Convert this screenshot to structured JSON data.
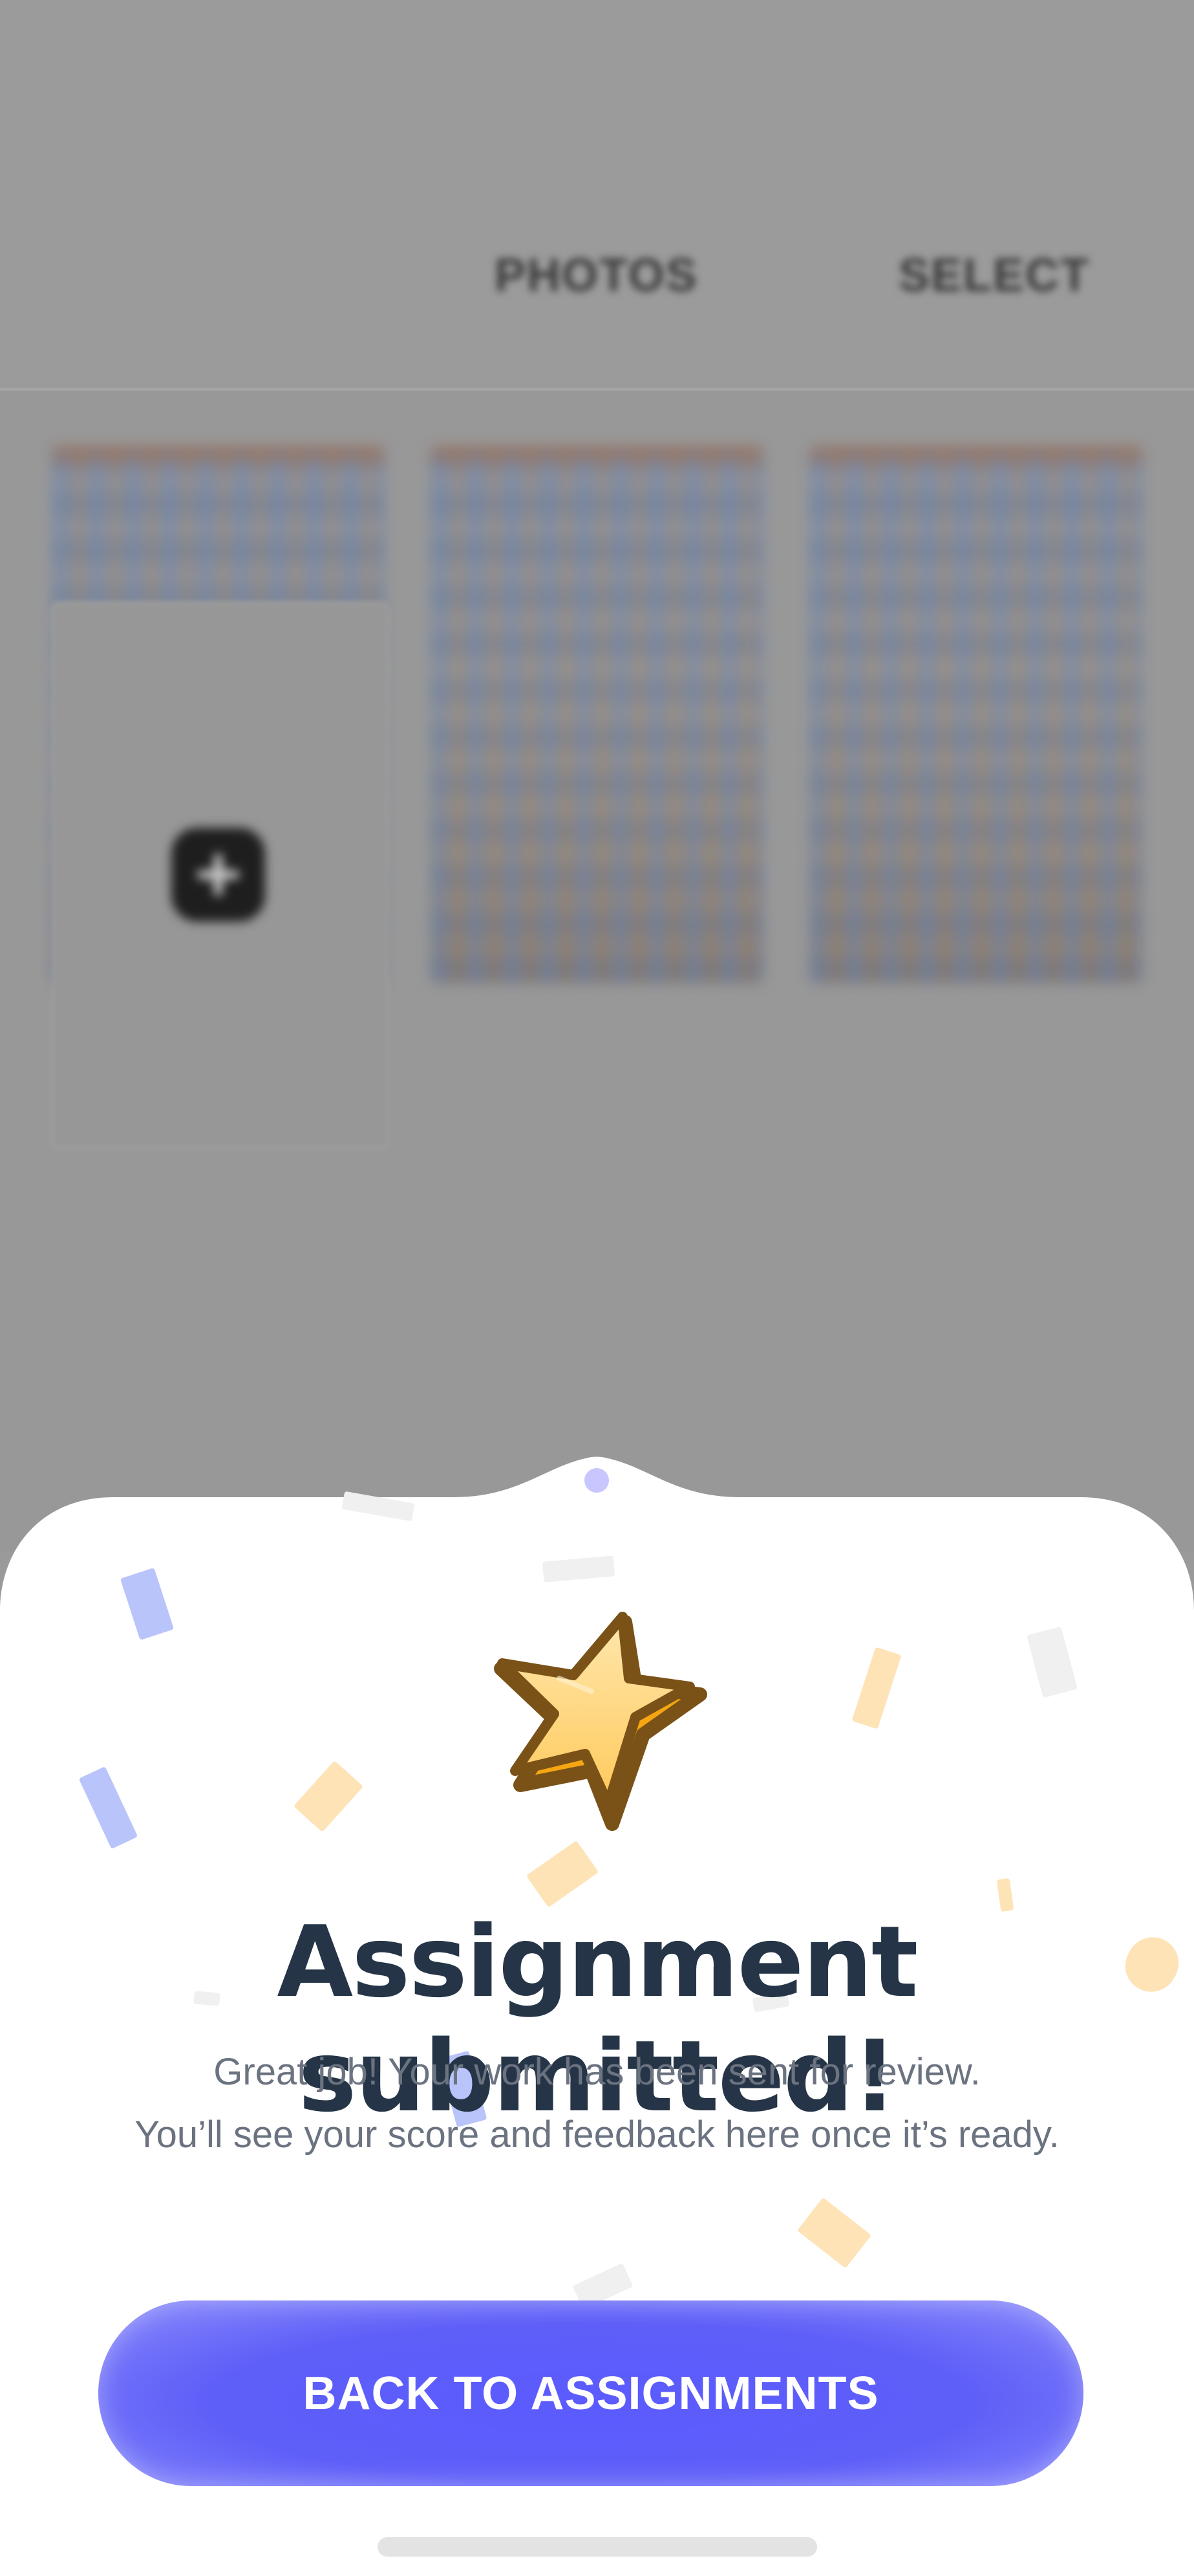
{
  "background": {
    "tabs": [
      {
        "label": "PHOTOS"
      },
      {
        "label": "SELECT"
      }
    ],
    "photo_count": 3
  },
  "sheet": {
    "title": "Assignment submitted!",
    "message_lines": [
      "Great job! Your work has been sent for review.",
      "You’ll see your score and feedback here once it’s ready."
    ],
    "button_label": "BACK TO ASSIGNMENTS",
    "icon": "star-icon"
  },
  "colors": {
    "accent": "#5b5bff",
    "title": "#253547",
    "body_text": "#6b7380",
    "confetti_blue": "#b9c4fb",
    "confetti_yellow": "#fde3b6",
    "confetti_grey": "#f0f0f0"
  }
}
